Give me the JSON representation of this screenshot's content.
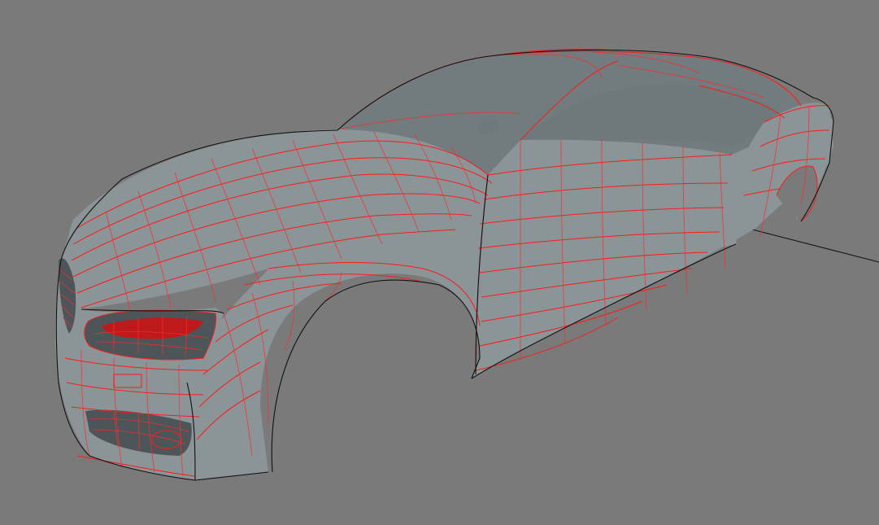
{
  "scene": {
    "background_color": "#7a7a7a",
    "object": "car-body-wireframe-model",
    "wire_color": "#ff1a1a",
    "surface_color": "#8b9497",
    "edge_color": "#111111"
  }
}
